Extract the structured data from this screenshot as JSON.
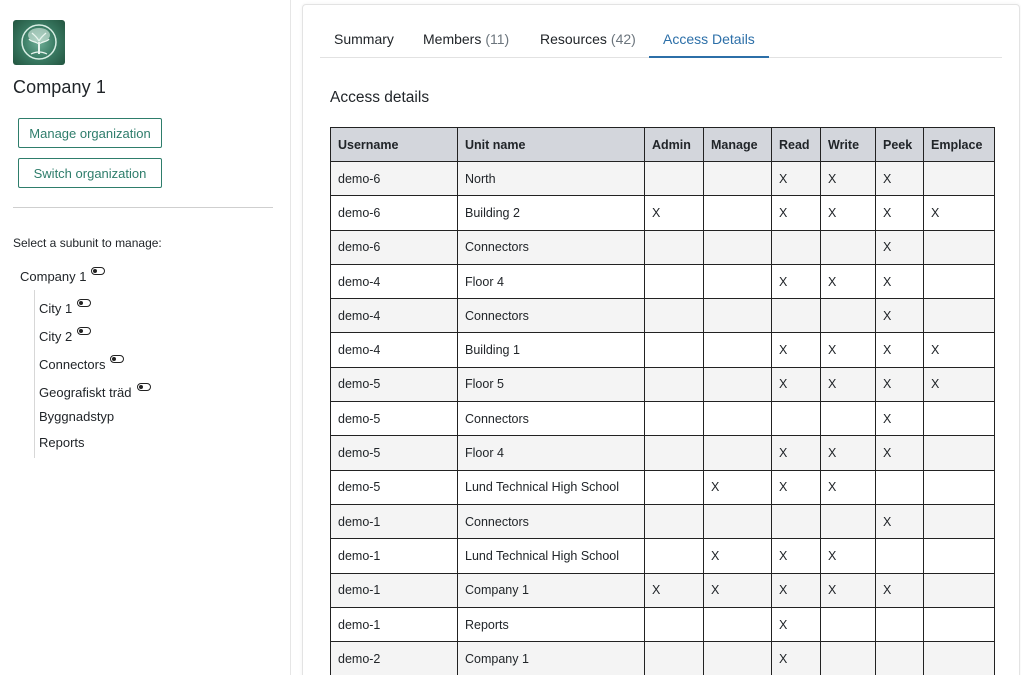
{
  "org": {
    "name": "Company 1",
    "manage_label": "Manage organization",
    "switch_label": "Switch organization",
    "subunit_prompt": "Select a subunit to manage:"
  },
  "tree": {
    "root": "Company 1",
    "children": [
      {
        "label": "City 1",
        "toggle": true
      },
      {
        "label": "City 2",
        "toggle": true
      },
      {
        "label": "Connectors",
        "toggle": true
      },
      {
        "label": "Geografiskt träd",
        "toggle": true
      },
      {
        "label": "Byggnadstyp",
        "toggle": false
      },
      {
        "label": "Reports",
        "toggle": false
      }
    ]
  },
  "tabs": [
    {
      "label": "Summary",
      "count": ""
    },
    {
      "label": "Members",
      "count": "(11)"
    },
    {
      "label": "Resources",
      "count": "(42)"
    },
    {
      "label": "Access Details",
      "count": "",
      "active": true
    }
  ],
  "section_title": "Access details",
  "table": {
    "headers": [
      "Username",
      "Unit name",
      "Admin",
      "Manage",
      "Read",
      "Write",
      "Peek",
      "Emplace"
    ],
    "rows": [
      [
        "demo-6",
        "North",
        "",
        "",
        "X",
        "X",
        "X",
        ""
      ],
      [
        "demo-6",
        "Building 2",
        "X",
        "",
        "X",
        "X",
        "X",
        "X"
      ],
      [
        "demo-6",
        "Connectors",
        "",
        "",
        "",
        "",
        "X",
        ""
      ],
      [
        "demo-4",
        "Floor 4",
        "",
        "",
        "X",
        "X",
        "X",
        ""
      ],
      [
        "demo-4",
        "Connectors",
        "",
        "",
        "",
        "",
        "X",
        ""
      ],
      [
        "demo-4",
        "Building 1",
        "",
        "",
        "X",
        "X",
        "X",
        "X"
      ],
      [
        "demo-5",
        "Floor 5",
        "",
        "",
        "X",
        "X",
        "X",
        "X"
      ],
      [
        "demo-5",
        "Connectors",
        "",
        "",
        "",
        "",
        "X",
        ""
      ],
      [
        "demo-5",
        "Floor 4",
        "",
        "",
        "X",
        "X",
        "X",
        ""
      ],
      [
        "demo-5",
        "Lund Technical High School",
        "",
        "X",
        "X",
        "X",
        "",
        ""
      ],
      [
        "demo-1",
        "Connectors",
        "",
        "",
        "",
        "",
        "X",
        ""
      ],
      [
        "demo-1",
        "Lund Technical High School",
        "",
        "X",
        "X",
        "X",
        "",
        ""
      ],
      [
        "demo-1",
        "Company 1",
        "X",
        "X",
        "X",
        "X",
        "X",
        ""
      ],
      [
        "demo-1",
        "Reports",
        "",
        "",
        "X",
        "",
        "",
        ""
      ],
      [
        "demo-2",
        "Company 1",
        "",
        "",
        "X",
        "",
        "",
        ""
      ]
    ]
  },
  "colors": {
    "accent_green": "#2e7d6b",
    "tab_active": "#2c6fa8",
    "header_bg": "#d3d6dc"
  },
  "icons": {
    "logo": "tree-logo-icon",
    "toggle": "toggle-icon"
  }
}
